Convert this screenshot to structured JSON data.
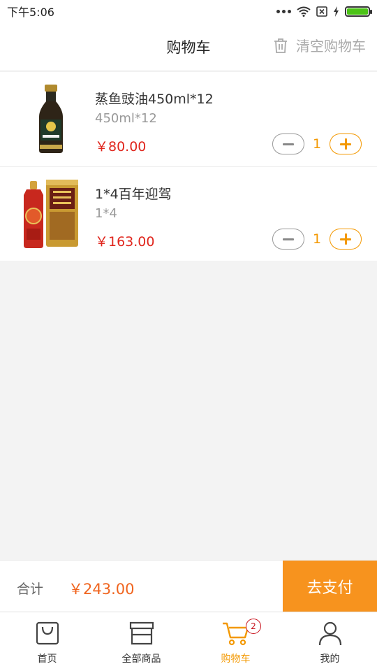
{
  "status_bar": {
    "time": "下午5:06"
  },
  "header": {
    "title": "购物车",
    "clear_label": "清空购物车"
  },
  "cart": {
    "items": [
      {
        "name": "蒸鱼豉油450ml*12",
        "spec": "450ml*12",
        "price": "￥80.00",
        "quantity": "1"
      },
      {
        "name": "1*4百年迎驾",
        "spec": "1*4",
        "price": "￥163.00",
        "quantity": "1"
      }
    ]
  },
  "summary": {
    "total_label": "合计",
    "total_amount": "￥243.00",
    "pay_label": "去支付"
  },
  "tabbar": {
    "tabs": [
      {
        "label": "首页",
        "icon": "bag-icon"
      },
      {
        "label": "全部商品",
        "icon": "store-icon"
      },
      {
        "label": "购物车",
        "icon": "cart-icon",
        "active": true,
        "badge": "2"
      },
      {
        "label": "我的",
        "icon": "person-icon"
      }
    ]
  },
  "colors": {
    "accent": "#f39800",
    "price": "#e0261d",
    "pay": "#f7931e",
    "badge": "#c8141e"
  }
}
